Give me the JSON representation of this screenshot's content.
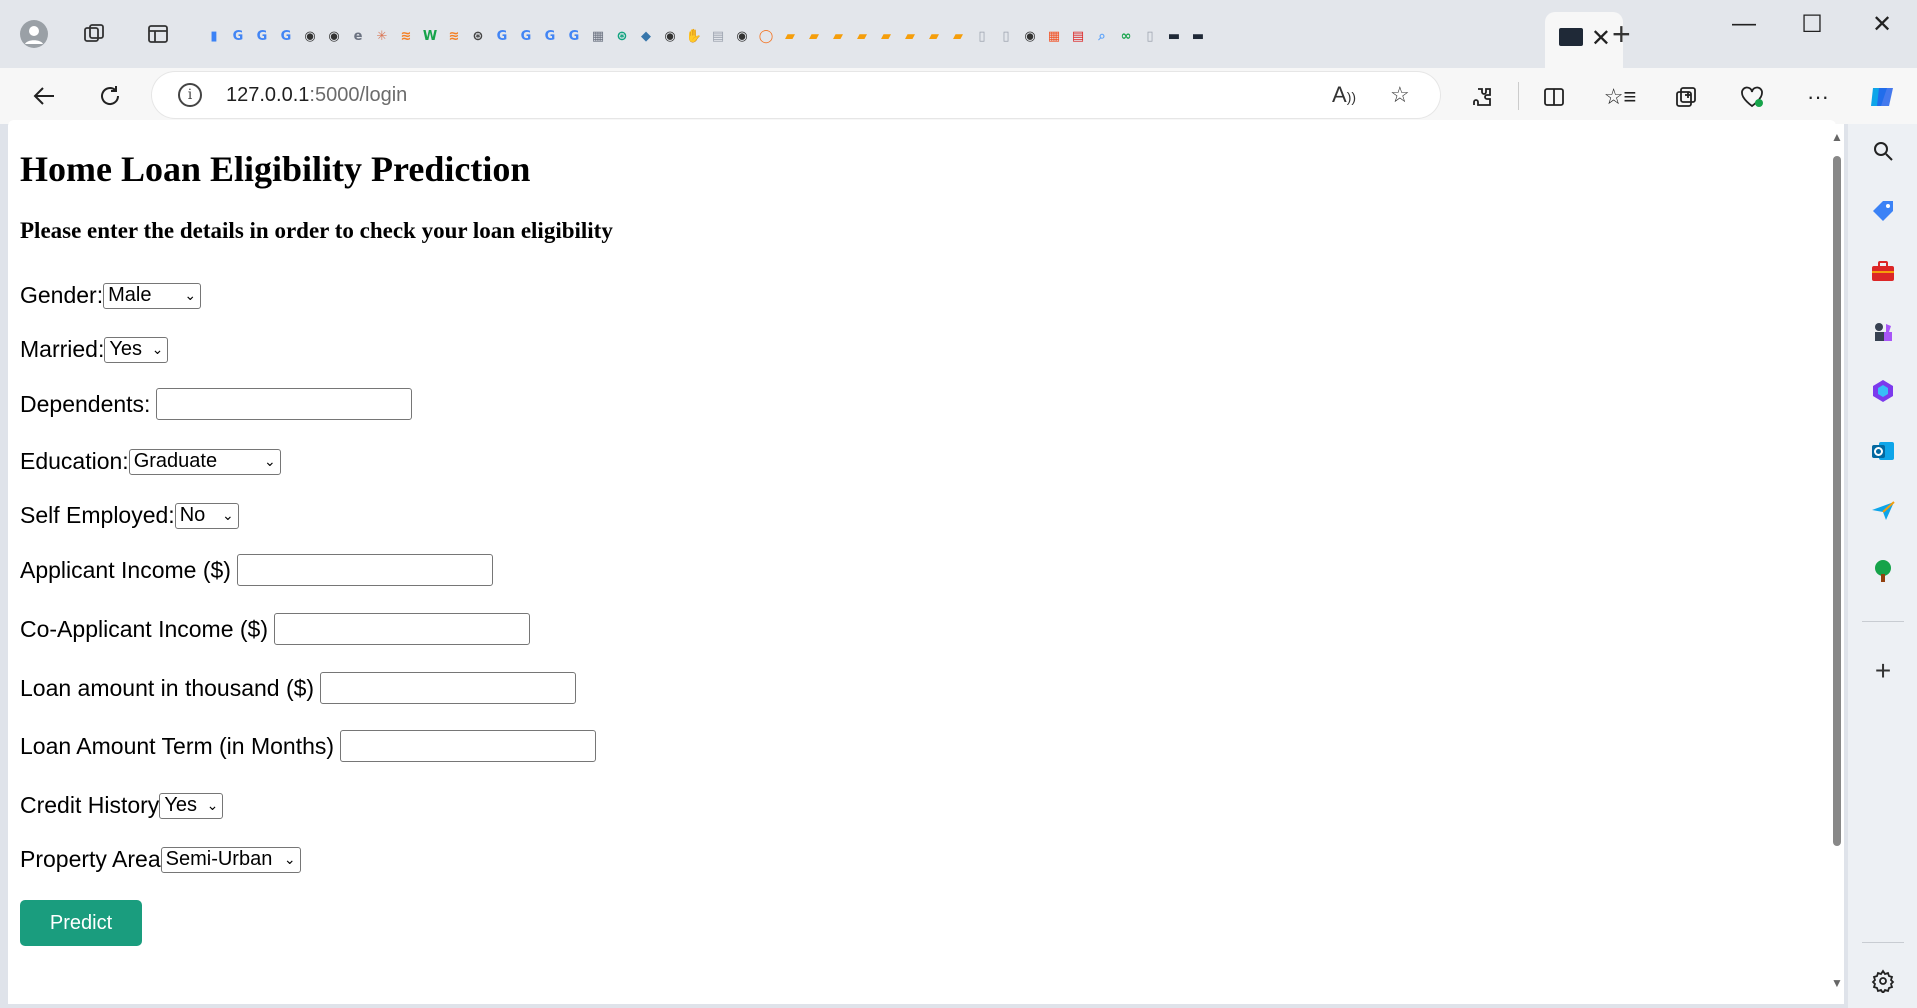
{
  "browser": {
    "url_host": "127.0.0.1",
    "url_path": ":5000/login",
    "tab_icons": [
      {
        "name": "doc-icon",
        "color": "#3b82f6",
        "glyph": "▮"
      },
      {
        "name": "google-icon",
        "color": "#4285f4",
        "glyph": "G"
      },
      {
        "name": "google-icon",
        "color": "#4285f4",
        "glyph": "G"
      },
      {
        "name": "google-icon",
        "color": "#4285f4",
        "glyph": "G"
      },
      {
        "name": "github-icon",
        "color": "#333333",
        "glyph": "◉"
      },
      {
        "name": "github-icon",
        "color": "#333333",
        "glyph": "◉"
      },
      {
        "name": "edge-icon",
        "color": "#6b7280",
        "glyph": "e"
      },
      {
        "name": "claude-icon",
        "color": "#d97757",
        "glyph": "✳"
      },
      {
        "name": "stack-icon",
        "color": "#f48024",
        "glyph": "≋"
      },
      {
        "name": "w-icon",
        "color": "#16a34a",
        "glyph": "W"
      },
      {
        "name": "stack-icon",
        "color": "#f48024",
        "glyph": "≋"
      },
      {
        "name": "openai-icon",
        "color": "#444444",
        "glyph": "⊛"
      },
      {
        "name": "google-icon",
        "color": "#4285f4",
        "glyph": "G"
      },
      {
        "name": "google-icon",
        "color": "#4285f4",
        "glyph": "G"
      },
      {
        "name": "google-icon",
        "color": "#4285f4",
        "glyph": "G"
      },
      {
        "name": "google-icon",
        "color": "#4285f4",
        "glyph": "G"
      },
      {
        "name": "table-icon",
        "color": "#6b7280",
        "glyph": "▦"
      },
      {
        "name": "chatgpt-icon",
        "color": "#10a37f",
        "glyph": "⊛"
      },
      {
        "name": "python-icon",
        "color": "#3776ab",
        "glyph": "◆"
      },
      {
        "name": "github-icon",
        "color": "#333333",
        "glyph": "◉"
      },
      {
        "name": "hand-icon",
        "color": "#c08040",
        "glyph": "✋"
      },
      {
        "name": "page-icon",
        "color": "#9ca3af",
        "glyph": "▤"
      },
      {
        "name": "github-icon",
        "color": "#333333",
        "glyph": "◉"
      },
      {
        "name": "jupyter-icon",
        "color": "#f37626",
        "glyph": "◯"
      },
      {
        "name": "book-icon",
        "color": "#f59e0b",
        "glyph": "▰"
      },
      {
        "name": "book-icon",
        "color": "#f59e0b",
        "glyph": "▰"
      },
      {
        "name": "book-icon",
        "color": "#f59e0b",
        "glyph": "▰"
      },
      {
        "name": "book-icon",
        "color": "#f59e0b",
        "glyph": "▰"
      },
      {
        "name": "book-icon",
        "color": "#f59e0b",
        "glyph": "▰"
      },
      {
        "name": "book-icon",
        "color": "#f59e0b",
        "glyph": "▰"
      },
      {
        "name": "book-icon",
        "color": "#f59e0b",
        "glyph": "▰"
      },
      {
        "name": "book-icon",
        "color": "#f59e0b",
        "glyph": "▰"
      },
      {
        "name": "file-icon",
        "color": "#9ca3af",
        "glyph": "▯"
      },
      {
        "name": "file-icon",
        "color": "#9ca3af",
        "glyph": "▯"
      },
      {
        "name": "github-icon",
        "color": "#333333",
        "glyph": "◉"
      },
      {
        "name": "microsoft-icon",
        "color": "#f25022",
        "glyph": "▦"
      },
      {
        "name": "pdf-icon",
        "color": "#dc2626",
        "glyph": "▤"
      },
      {
        "name": "search-icon",
        "color": "#60a5fa",
        "glyph": "⌕"
      },
      {
        "name": "link-icon",
        "color": "#16a34a",
        "glyph": "∞"
      },
      {
        "name": "file-icon",
        "color": "#9ca3af",
        "glyph": "▯"
      },
      {
        "name": "terminal-icon",
        "color": "#1f2937",
        "glyph": "▬"
      },
      {
        "name": "terminal-icon",
        "color": "#1f2937",
        "glyph": "▬"
      }
    ]
  },
  "page": {
    "title": "Home Loan Eligibility Prediction",
    "subtitle": "Please enter the details in order to check your loan eligibility",
    "gender_label": "Gender:",
    "gender_value": "Male",
    "married_label": "Married:",
    "married_value": "Yes",
    "dependents_label": "Dependents:",
    "education_label": "Education:",
    "education_value": "Graduate",
    "self_employed_label": "Self Employed:",
    "self_employed_value": "No",
    "applicant_income_label": "Applicant Income ($)",
    "coapplicant_income_label": "Co-Applicant Income ($)",
    "loan_amount_label": "Loan amount in thousand ($)",
    "loan_term_label": "Loan Amount Term (in Months)",
    "credit_history_label": "Credit History",
    "credit_history_value": "Yes",
    "property_area_label": "Property Area",
    "property_area_value": "Semi-Urban",
    "predict_label": "Predict",
    "predict_color": "#1a9d7e"
  }
}
